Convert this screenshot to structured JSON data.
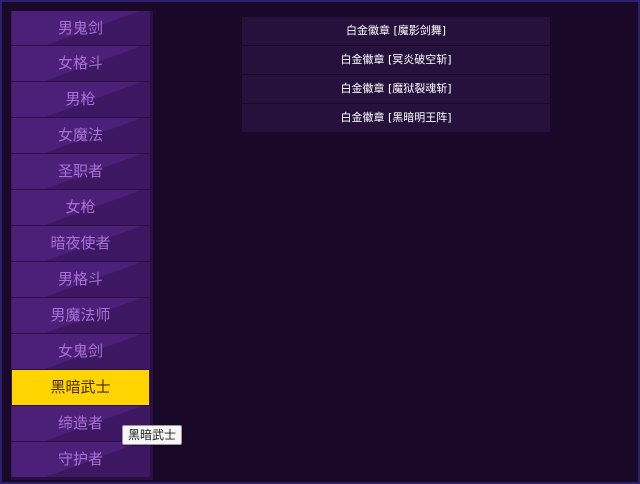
{
  "sidebar": {
    "classes": [
      {
        "label": "男鬼剑"
      },
      {
        "label": "女格斗"
      },
      {
        "label": "男枪"
      },
      {
        "label": "女魔法"
      },
      {
        "label": "圣职者"
      },
      {
        "label": "女枪"
      },
      {
        "label": "暗夜使者"
      },
      {
        "label": "男格斗"
      },
      {
        "label": "男魔法师"
      },
      {
        "label": "女鬼剑"
      },
      {
        "label": "黑暗武士"
      },
      {
        "label": "缔造者"
      },
      {
        "label": "守护者"
      }
    ],
    "selected_index": 10,
    "selected_color": "#ffd400"
  },
  "tooltip": {
    "text": "黑暗武士"
  },
  "badges": {
    "items": [
      {
        "label": "白金徽章 [魔影剑舞]"
      },
      {
        "label": "白金徽章 [冥炎破空斩]"
      },
      {
        "label": "白金徽章 [魔狱裂魂斩]"
      },
      {
        "label": "白金徽章 [黑暗明王阵]"
      }
    ]
  },
  "colors": {
    "background": "#1a0828",
    "item_bg": "#4c1f78",
    "item_text": "#a672d6",
    "badge_bg": "#26103c"
  }
}
